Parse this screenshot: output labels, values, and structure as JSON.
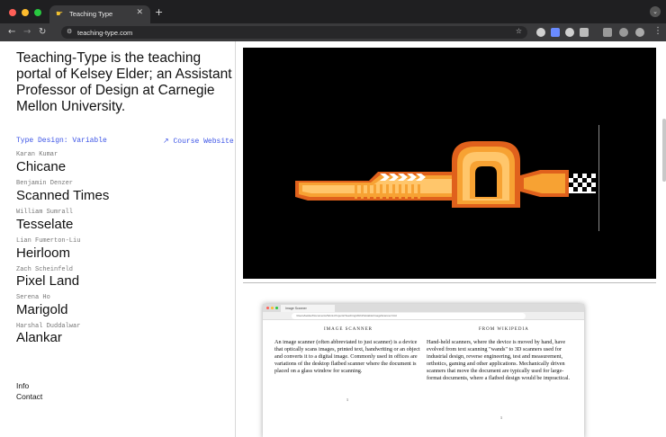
{
  "browser": {
    "tab_title": "Teaching Type",
    "tab_favicon": "☛",
    "close_glyph": "✕",
    "new_tab_glyph": "+",
    "url": "teaching-type.com",
    "icons": [
      "back-arrow-icon",
      "forward-arrow-icon",
      "reload-icon",
      "site-info-icon",
      "bookmark-star-icon",
      "extension-icons",
      "chrome-menu-icon"
    ]
  },
  "sidebar": {
    "intro": "Teaching-Type is the teaching portal of Kelsey Elder; an Assistant Professor of Design at Carnegie Mellon University.",
    "section_label": "Type Design: Variable",
    "course_link": "↗ Course Website",
    "projects": [
      {
        "designer": "Karan Kumar",
        "typeface": "Chicane"
      },
      {
        "designer": "Benjamin Denzer",
        "typeface": "Scanned Times"
      },
      {
        "designer": "William Sumrall",
        "typeface": "Tesselate"
      },
      {
        "designer": "Lian Fumerton-Liu",
        "typeface": "Heirloom"
      },
      {
        "designer": "Zach Scheinfeld",
        "typeface": "Pixel Land"
      },
      {
        "designer": "Serena Ho",
        "typeface": "Marigold"
      },
      {
        "designer": "Harshal Duddalwar",
        "typeface": "Alankar"
      }
    ],
    "footer": {
      "info": "Info",
      "contact": "Contact"
    }
  },
  "inner_screenshot": {
    "tab_title": "Image Scanner",
    "url": "/Users/kelder/Documents/Work-Projects/Teaching/2024/Variable/ImageScanner.html",
    "left_heading": "IMAGE SCANNER",
    "right_heading": "FROM WIKIPEDIA",
    "left_text": "An image scanner (often abbreviated to just scanner) is a device that optically scans images, printed text, handwriting or an object and converts it to a digital image. Commonly used in offices are variations of the desktop flatbed scanner where the document is placed on a glass window for scanning.",
    "right_text": "Hand-held scanners, where the device is moved by hand, have evolved from text scanning \"wands\" to 3D scanners used for industrial design, reverse engineering, test and measurement, orthotics, gaming and other applications. Mechanically driven scanners that move the document are typically used for large-format documents, where a flatbed design would be impractical.",
    "left_page": "1",
    "right_page": "1"
  },
  "colors": {
    "accent": "#3b53e6",
    "chicane_orange": "#f7a233",
    "chicane_light": "#ffc66b",
    "chicane_dark": "#e0611c"
  }
}
